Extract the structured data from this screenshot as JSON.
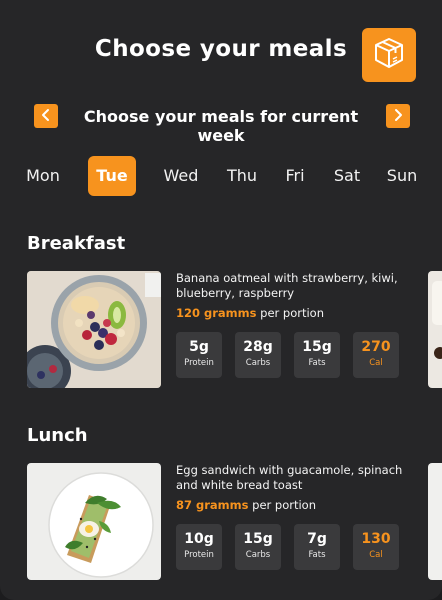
{
  "header": {
    "title": "Choose your meals",
    "box_icon": "package-box-icon"
  },
  "week": {
    "label": "Choose your meals for current week",
    "prev_icon": "chevron-left-icon",
    "next_icon": "chevron-right-icon"
  },
  "days": [
    {
      "label": "Mon",
      "active": false
    },
    {
      "label": "Tue",
      "active": true
    },
    {
      "label": "Wed",
      "active": false
    },
    {
      "label": "Thu",
      "active": false
    },
    {
      "label": "Fri",
      "active": false
    },
    {
      "label": "Sat",
      "active": false
    },
    {
      "label": "Sun",
      "active": false
    }
  ],
  "sections": [
    {
      "title": "Breakfast",
      "meal": {
        "name": "Banana oatmeal with strawberry, kiwi, blueberry, raspberry",
        "portion_amount": "120 gramms",
        "portion_suffix": "per portion",
        "stats": [
          {
            "value": "5g",
            "label": "Protein"
          },
          {
            "value": "28g",
            "label": "Carbs"
          },
          {
            "value": "15g",
            "label": "Fats"
          },
          {
            "value": "270",
            "label": "Cal"
          }
        ]
      }
    },
    {
      "title": "Lunch",
      "meal": {
        "name": "Egg sandwich with guacamole, spinach and white bread toast",
        "portion_amount": "87 gramms",
        "portion_suffix": "per portion",
        "stats": [
          {
            "value": "10g",
            "label": "Protein"
          },
          {
            "value": "15g",
            "label": "Carbs"
          },
          {
            "value": "7g",
            "label": "Fats"
          },
          {
            "value": "130",
            "label": "Cal"
          }
        ]
      }
    }
  ],
  "colors": {
    "accent": "#f7931e",
    "background": "#262628",
    "stat_tile": "#3a3a3c"
  }
}
